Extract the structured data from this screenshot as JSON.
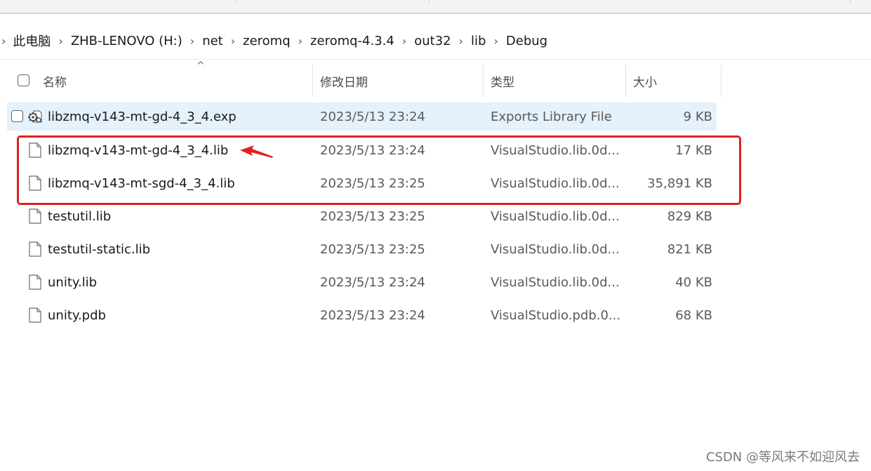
{
  "breadcrumb": {
    "items": [
      "此电脑",
      "ZHB-LENOVO (H:)",
      "net",
      "zeromq",
      "zeromq-4.3.4",
      "out32",
      "lib",
      "Debug"
    ]
  },
  "columns": {
    "name": "名称",
    "date": "修改日期",
    "type": "类型",
    "size": "大小"
  },
  "files": [
    {
      "name": "libzmq-v143-mt-gd-4_3_4.exp",
      "date": "2023/5/13 23:24",
      "type": "Exports Library File",
      "size": "9 KB",
      "icon": "exp-settings-icon",
      "selected": true
    },
    {
      "name": "libzmq-v143-mt-gd-4_3_4.lib",
      "date": "2023/5/13 23:24",
      "type": "VisualStudio.lib.0d...",
      "size": "17 KB",
      "icon": "file-icon"
    },
    {
      "name": "libzmq-v143-mt-sgd-4_3_4.lib",
      "date": "2023/5/13 23:25",
      "type": "VisualStudio.lib.0d...",
      "size": "35,891 KB",
      "icon": "file-icon"
    },
    {
      "name": "testutil.lib",
      "date": "2023/5/13 23:25",
      "type": "VisualStudio.lib.0d...",
      "size": "829 KB",
      "icon": "file-icon"
    },
    {
      "name": "testutil-static.lib",
      "date": "2023/5/13 23:25",
      "type": "VisualStudio.lib.0d...",
      "size": "821 KB",
      "icon": "file-icon"
    },
    {
      "name": "unity.lib",
      "date": "2023/5/13 23:24",
      "type": "VisualStudio.lib.0d...",
      "size": "40 KB",
      "icon": "file-icon"
    },
    {
      "name": "unity.pdb",
      "date": "2023/5/13 23:24",
      "type": "VisualStudio.pdb.0...",
      "size": "68 KB",
      "icon": "file-icon"
    }
  ],
  "annotation": {
    "color": "#e02020"
  },
  "watermark": "CSDN @等风来不如迎风去",
  "colors": {
    "selected_row": "#e5f1fb",
    "annotation_red": "#e02020"
  }
}
